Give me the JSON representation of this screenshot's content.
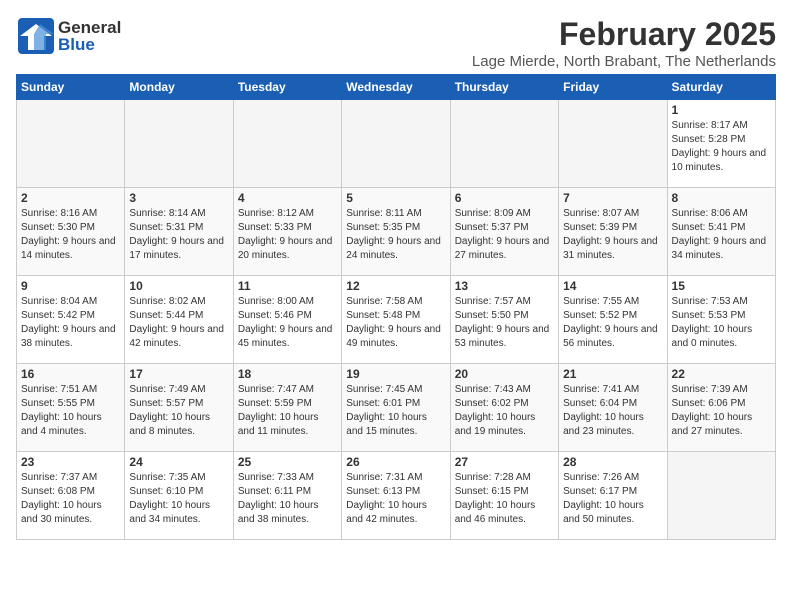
{
  "header": {
    "logo_general": "General",
    "logo_blue": "Blue",
    "title": "February 2025",
    "location": "Lage Mierde, North Brabant, The Netherlands"
  },
  "weekdays": [
    "Sunday",
    "Monday",
    "Tuesday",
    "Wednesday",
    "Thursday",
    "Friday",
    "Saturday"
  ],
  "weeks": [
    [
      {
        "day": "",
        "info": ""
      },
      {
        "day": "",
        "info": ""
      },
      {
        "day": "",
        "info": ""
      },
      {
        "day": "",
        "info": ""
      },
      {
        "day": "",
        "info": ""
      },
      {
        "day": "",
        "info": ""
      },
      {
        "day": "1",
        "info": "Sunrise: 8:17 AM\nSunset: 5:28 PM\nDaylight: 9 hours and 10 minutes."
      }
    ],
    [
      {
        "day": "2",
        "info": "Sunrise: 8:16 AM\nSunset: 5:30 PM\nDaylight: 9 hours and 14 minutes."
      },
      {
        "day": "3",
        "info": "Sunrise: 8:14 AM\nSunset: 5:31 PM\nDaylight: 9 hours and 17 minutes."
      },
      {
        "day": "4",
        "info": "Sunrise: 8:12 AM\nSunset: 5:33 PM\nDaylight: 9 hours and 20 minutes."
      },
      {
        "day": "5",
        "info": "Sunrise: 8:11 AM\nSunset: 5:35 PM\nDaylight: 9 hours and 24 minutes."
      },
      {
        "day": "6",
        "info": "Sunrise: 8:09 AM\nSunset: 5:37 PM\nDaylight: 9 hours and 27 minutes."
      },
      {
        "day": "7",
        "info": "Sunrise: 8:07 AM\nSunset: 5:39 PM\nDaylight: 9 hours and 31 minutes."
      },
      {
        "day": "8",
        "info": "Sunrise: 8:06 AM\nSunset: 5:41 PM\nDaylight: 9 hours and 34 minutes."
      }
    ],
    [
      {
        "day": "9",
        "info": "Sunrise: 8:04 AM\nSunset: 5:42 PM\nDaylight: 9 hours and 38 minutes."
      },
      {
        "day": "10",
        "info": "Sunrise: 8:02 AM\nSunset: 5:44 PM\nDaylight: 9 hours and 42 minutes."
      },
      {
        "day": "11",
        "info": "Sunrise: 8:00 AM\nSunset: 5:46 PM\nDaylight: 9 hours and 45 minutes."
      },
      {
        "day": "12",
        "info": "Sunrise: 7:58 AM\nSunset: 5:48 PM\nDaylight: 9 hours and 49 minutes."
      },
      {
        "day": "13",
        "info": "Sunrise: 7:57 AM\nSunset: 5:50 PM\nDaylight: 9 hours and 53 minutes."
      },
      {
        "day": "14",
        "info": "Sunrise: 7:55 AM\nSunset: 5:52 PM\nDaylight: 9 hours and 56 minutes."
      },
      {
        "day": "15",
        "info": "Sunrise: 7:53 AM\nSunset: 5:53 PM\nDaylight: 10 hours and 0 minutes."
      }
    ],
    [
      {
        "day": "16",
        "info": "Sunrise: 7:51 AM\nSunset: 5:55 PM\nDaylight: 10 hours and 4 minutes."
      },
      {
        "day": "17",
        "info": "Sunrise: 7:49 AM\nSunset: 5:57 PM\nDaylight: 10 hours and 8 minutes."
      },
      {
        "day": "18",
        "info": "Sunrise: 7:47 AM\nSunset: 5:59 PM\nDaylight: 10 hours and 11 minutes."
      },
      {
        "day": "19",
        "info": "Sunrise: 7:45 AM\nSunset: 6:01 PM\nDaylight: 10 hours and 15 minutes."
      },
      {
        "day": "20",
        "info": "Sunrise: 7:43 AM\nSunset: 6:02 PM\nDaylight: 10 hours and 19 minutes."
      },
      {
        "day": "21",
        "info": "Sunrise: 7:41 AM\nSunset: 6:04 PM\nDaylight: 10 hours and 23 minutes."
      },
      {
        "day": "22",
        "info": "Sunrise: 7:39 AM\nSunset: 6:06 PM\nDaylight: 10 hours and 27 minutes."
      }
    ],
    [
      {
        "day": "23",
        "info": "Sunrise: 7:37 AM\nSunset: 6:08 PM\nDaylight: 10 hours and 30 minutes."
      },
      {
        "day": "24",
        "info": "Sunrise: 7:35 AM\nSunset: 6:10 PM\nDaylight: 10 hours and 34 minutes."
      },
      {
        "day": "25",
        "info": "Sunrise: 7:33 AM\nSunset: 6:11 PM\nDaylight: 10 hours and 38 minutes."
      },
      {
        "day": "26",
        "info": "Sunrise: 7:31 AM\nSunset: 6:13 PM\nDaylight: 10 hours and 42 minutes."
      },
      {
        "day": "27",
        "info": "Sunrise: 7:28 AM\nSunset: 6:15 PM\nDaylight: 10 hours and 46 minutes."
      },
      {
        "day": "28",
        "info": "Sunrise: 7:26 AM\nSunset: 6:17 PM\nDaylight: 10 hours and 50 minutes."
      },
      {
        "day": "",
        "info": ""
      }
    ]
  ]
}
